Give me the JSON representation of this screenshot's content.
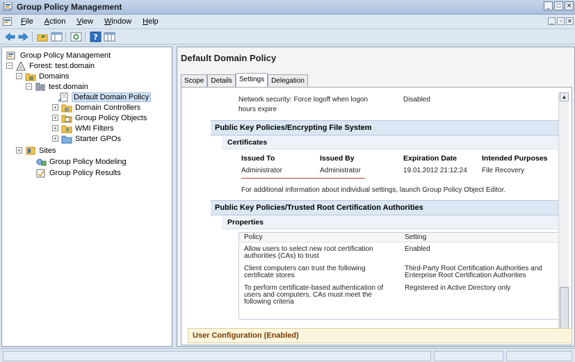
{
  "window": {
    "title": "Group Policy Management"
  },
  "menu": [
    {
      "label": "File",
      "mnemonic": "F",
      "rest": "ile"
    },
    {
      "label": "Action",
      "mnemonic": "A",
      "rest": "ction"
    },
    {
      "label": "View",
      "mnemonic": "V",
      "rest": "iew"
    },
    {
      "label": "Window",
      "mnemonic": "W",
      "rest": "indow"
    },
    {
      "label": "Help",
      "mnemonic": "H",
      "rest": "elp"
    }
  ],
  "tree": {
    "root": "Group Policy Management",
    "forest": "Forest: test.domain",
    "domains": "Domains",
    "domain": "test.domain",
    "default_policy": "Default Domain Policy",
    "domain_controllers": "Domain Controllers",
    "gpo": "Group Policy Objects",
    "wmi": "WMI Filters",
    "starter": "Starter GPOs",
    "sites": "Sites",
    "modeling": "Group Policy Modeling",
    "results": "Group Policy Results"
  },
  "right": {
    "title": "Default Domain Policy",
    "tabs": [
      "Scope",
      "Details",
      "Settings",
      "Delegation"
    ],
    "network_line1": "Network security: Force logoff when logon",
    "network_line2": "hours expire",
    "network_value": "Disabled",
    "pk_header": "Public Key Policies/Encrypting File System",
    "cert_subheader": "Certificates",
    "cert_cols": [
      "Issued To",
      "Issued By",
      "Expiration Date",
      "Intended Purposes"
    ],
    "cert_row": [
      "Administrator",
      "Administrator",
      "19.01.2012 21:12:24",
      "File Recovery"
    ],
    "additional_info": "For additional information about individual settings, launch Group Policy Object Editor.",
    "trusted_header": "Public Key Policies/Trusted Root Certification Authorities",
    "props_subheader": "Properties",
    "props_cols": [
      "Policy",
      "Setting"
    ],
    "props_rows": [
      {
        "policy1": "Allow users to select new root certification",
        "policy2": "authorities (CAs) to trust",
        "policy3": "",
        "setting1": "Enabled",
        "setting2": ""
      },
      {
        "policy1": "Client computers can trust the following",
        "policy2": "certificate stores",
        "policy3": "",
        "setting1": "Third-Party Root Certification Authorities and",
        "setting2": "Enterprise Root Certification Authorities"
      },
      {
        "policy1": "To perform certificate-based authentication of",
        "policy2": "users and computers, CAs must meet the",
        "policy3": "following criteria",
        "setting1": "Registered in Active Directory only",
        "setting2": ""
      }
    ],
    "user_config": "User Configuration (Enabled)"
  },
  "colors": {
    "accent": "#1a4f8a",
    "section_bg": "#dce7f3",
    "footer_bg": "#fbf5dd"
  }
}
